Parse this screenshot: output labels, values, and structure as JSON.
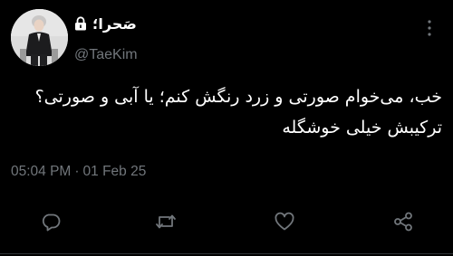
{
  "tweet": {
    "author": {
      "display_name": "صَحرا؛",
      "handle": "@TaeKim",
      "protected_icon": "lock-icon",
      "avatar": "avatar-photo"
    },
    "menu_icon": "more-vertical-icon",
    "text_lines": [
      "خب، می‌خوام صورتی و زرد رنگش کنم؛ یا آبی و صورتی؟",
      "ترکیبش خیلی خوشگله"
    ],
    "time": "05:04 PM",
    "separator": "·",
    "date": "01 Feb 25",
    "actions": {
      "reply_icon": "reply-icon",
      "retweet_icon": "retweet-icon",
      "like_icon": "heart-icon",
      "share_icon": "share-icon"
    },
    "colors": {
      "background": "#000000",
      "primary_text": "#ffffff",
      "secondary_text": "#71767b",
      "icon_color": "#71767b"
    }
  }
}
